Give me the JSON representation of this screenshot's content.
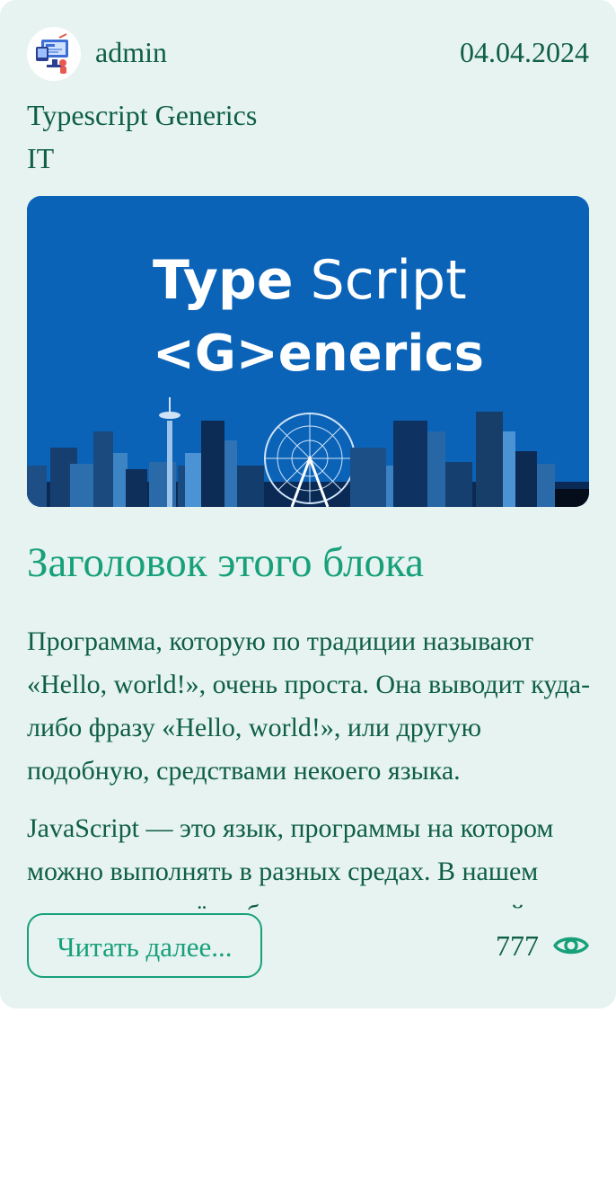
{
  "post": {
    "author": "admin",
    "date": "04.04.2024",
    "tag_title": "Typescript Generics",
    "category": "IT",
    "cover": {
      "line1_bold": "Type",
      "line1_light": " Script",
      "line2": "<G>enerics"
    },
    "heading": "Заголовок этого блока",
    "paragraphs": [
      "Программа, которую по традиции называют «Hello, world!», очень проста. Она выводит куда-либо фразу «Hello, world!», или другую подобную, средствами некоего языка.",
      "JavaScript — это язык, программы на котором можно выполнять в разных средах. В нашем случае речь идёт о браузерах и о серверной"
    ],
    "read_more_label": "Читать далее...",
    "views": "777",
    "icons": {
      "avatar": "avatar-illustration",
      "views": "eye-icon"
    },
    "colors": {
      "card_bg": "#e6f3f0",
      "accent": "#17a07a",
      "text": "#0f5e46",
      "cover_bg": "#0b63b8"
    }
  }
}
